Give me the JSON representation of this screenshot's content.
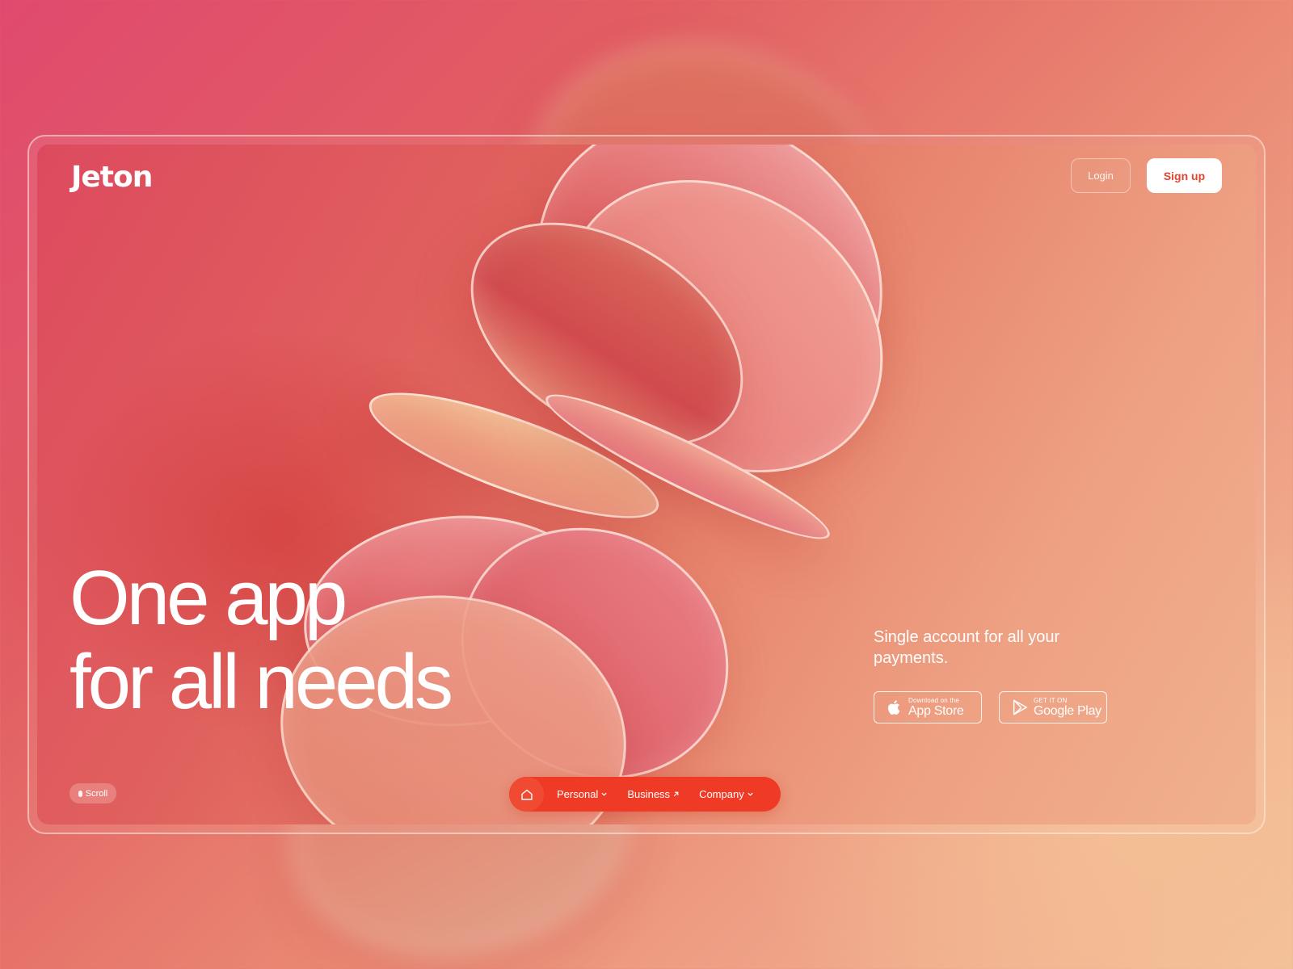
{
  "brand": {
    "logo": "Jeton"
  },
  "header": {
    "login_label": "Login",
    "signup_label": "Sign up"
  },
  "hero": {
    "line1": "One app",
    "line2": "for all needs"
  },
  "tagline": "Single account for all your payments.",
  "stores": {
    "apple": {
      "small": "Download on the",
      "big": "App Store"
    },
    "google": {
      "small": "GET IT ON",
      "big": "Google Play"
    }
  },
  "scroll_label": "Scroll",
  "nav": {
    "items": [
      {
        "label": "Personal",
        "icon": "chevron-down-icon"
      },
      {
        "label": "Business",
        "icon": "arrow-up-right-icon"
      },
      {
        "label": "Company",
        "icon": "chevron-down-icon"
      }
    ]
  },
  "colors": {
    "accent": "#ef3b26",
    "signup_text": "#e0452e",
    "background_start": "#e04a6e",
    "background_end": "#f3c19a"
  }
}
